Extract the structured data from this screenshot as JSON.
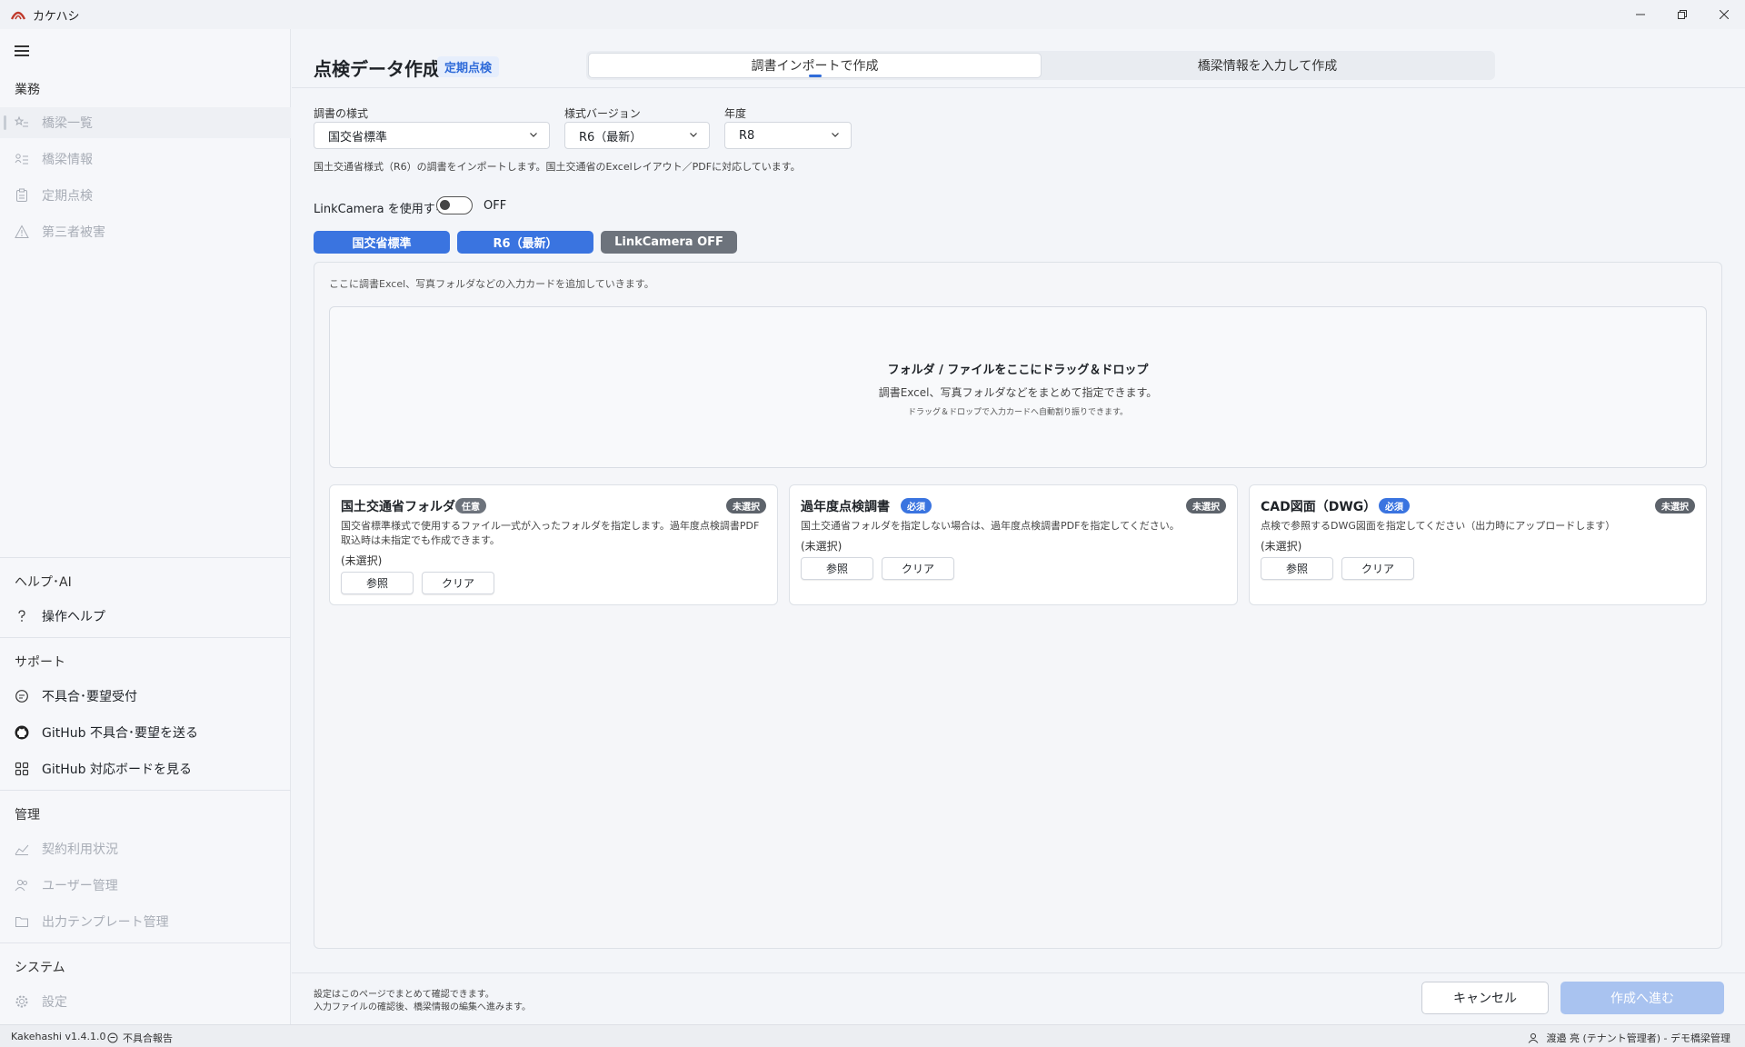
{
  "app": {
    "title": "カケハシ"
  },
  "sidebar": {
    "section_work": "業務",
    "work_items": [
      {
        "label": "橋梁一覧",
        "icon": "star-list-icon"
      },
      {
        "label": "橋梁情報",
        "icon": "person-list-icon"
      },
      {
        "label": "定期点検",
        "icon": "clipboard-icon"
      },
      {
        "label": "第三者被害",
        "icon": "warning-icon"
      }
    ],
    "section_help": "ヘルプ･AI",
    "help_items": [
      {
        "label": "操作ヘルプ",
        "icon": "question-icon"
      }
    ],
    "section_support": "サポート",
    "support_items": [
      {
        "label": "不具合･要望受付",
        "icon": "chat-icon"
      },
      {
        "label": "GitHub 不具合･要望を送る",
        "icon": "github-icon"
      },
      {
        "label": "GitHub 対応ボードを見る",
        "icon": "board-icon"
      }
    ],
    "section_admin": "管理",
    "admin_items": [
      {
        "label": "契約利用状況",
        "icon": "chart-icon"
      },
      {
        "label": "ユーザー管理",
        "icon": "users-icon"
      },
      {
        "label": "出力テンプレート管理",
        "icon": "folder-icon"
      }
    ],
    "section_system": "システム",
    "system_items": [
      {
        "label": "設定",
        "icon": "gear-icon"
      }
    ]
  },
  "main": {
    "title": "点検データ作成",
    "tag": "定期点検",
    "tabs": [
      {
        "label": "調書インポートで作成",
        "active": true
      },
      {
        "label": "橋梁情報を入力して作成",
        "active": false
      }
    ],
    "fields": {
      "format_label": "調書の様式",
      "format_value": "国交省標準",
      "version_label": "様式バージョン",
      "version_value": "R6（最新）",
      "year_label": "年度",
      "year_value": "R8"
    },
    "hint": "国土交通省様式（R6）の調書をインポートします。国土交通省のExcelレイアウト／PDFに対応しています。",
    "linkcamera_label": "LinkCamera を使用する",
    "linkcamera_state": "OFF",
    "chips": [
      "国交省標準",
      "R6（最新）",
      "LinkCamera  OFF"
    ],
    "panel_hint": "ここに調書Excel、写真フォルダなどの入力カードを追加していきます。",
    "dropzone": {
      "title": "フォルダ / ファイルをここにドラッグ＆ドロップ",
      "sub": "調書Excel、写真フォルダなどをまとめて指定できます。",
      "sub2": "ドラッグ＆ドロップで入力カードへ自動割り振りできます。"
    },
    "cards": [
      {
        "title": "国土交通省フォルダ",
        "badge": "任意",
        "status": "未選択",
        "desc": "国交省標準様式で使用するファイル一式が入ったフォルダを指定します。過年度点検調書PDF取込時は未指定でも作成できます。",
        "value": "(未選択)",
        "browse": "参照",
        "clear": "クリア"
      },
      {
        "title": "過年度点検調書",
        "badge": "必須",
        "status": "未選択",
        "desc": "国土交通省フォルダを指定しない場合は、過年度点検調書PDFを指定してください。",
        "value": "(未選択)",
        "browse": "参照",
        "clear": "クリア"
      },
      {
        "title": "CAD図面（DWG）",
        "badge": "必須",
        "status": "未選択",
        "desc": "点検で参照するDWG図面を指定してください（出力時にアップロードします）",
        "value": "(未選択)",
        "browse": "参照",
        "clear": "クリア"
      }
    ],
    "footer_note1": "設定はこのページでまとめて確認できます。",
    "footer_note2": "入力ファイルの確認後、橋梁情報の編集へ進みます。",
    "cancel": "キャンセル",
    "proceed": "作成へ進む"
  },
  "statusbar": {
    "version": "Kakehashi v1.4.1.0",
    "report": "不具合報告",
    "user": "渡邉 亮 (テナント管理者) - デモ橋梁管理"
  },
  "colors": {
    "accent": "#3a74e0",
    "tag_bg": "#e6eefc",
    "disabled_btn": "#a9c3f0"
  }
}
